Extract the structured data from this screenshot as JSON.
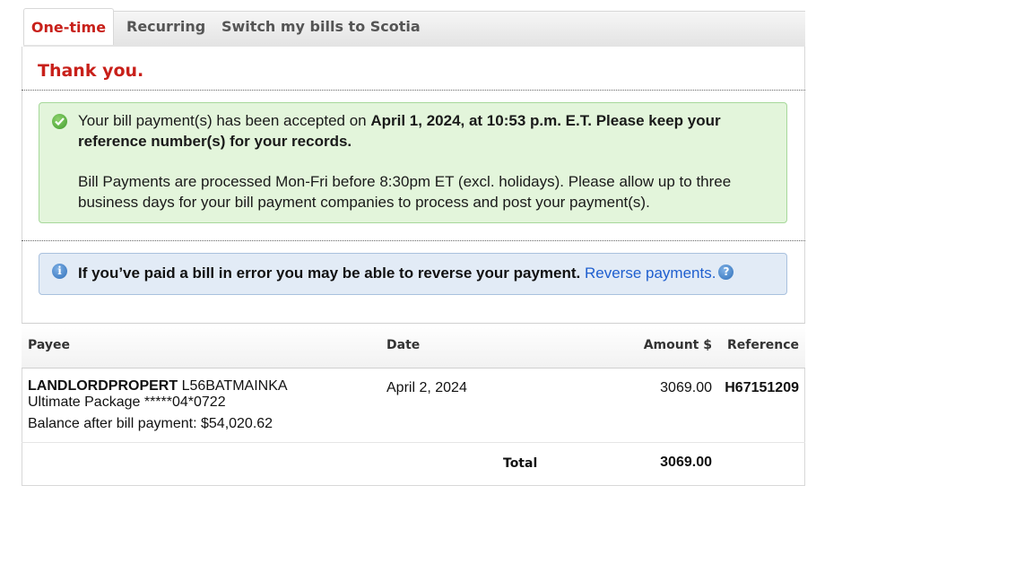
{
  "tabs": [
    {
      "label": "One-time",
      "active": true
    },
    {
      "label": "Recurring",
      "active": false
    },
    {
      "label": "Switch my bills to Scotia",
      "active": false
    }
  ],
  "heading": "Thank you.",
  "success": {
    "text_plain": "Your bill payment(s) has been accepted on ",
    "text_bold": "April 1, 2024, at 10:53 p.m. E.T. Please keep your reference number(s) for your records.",
    "processing_note": "Bill Payments are processed Mon-Fri before 8:30pm ET (excl. holidays). Please allow up to three business days for your bill payment companies to process and post your payment(s).",
    "icon": "check-circle-icon",
    "color": "#e3f5db"
  },
  "info": {
    "text": "If you’ve paid a bill in error you may be able to reverse your payment.",
    "link": "Reverse payments.",
    "icon": "info-icon",
    "help_icon": "question-icon",
    "color": "#e2ebf6"
  },
  "table": {
    "headers": {
      "payee": "Payee",
      "date": "Date",
      "amount": "Amount $",
      "reference": "Reference"
    },
    "rows": [
      {
        "payee_name": "LANDLORDPROPERT",
        "payee_code": "L56BATMAINKA",
        "account": "Ultimate Package *****04*0722",
        "balance": "Balance after bill payment: $54,020.62",
        "date": "April 2, 2024",
        "amount": "3069.00",
        "reference": "H67151209"
      }
    ],
    "total_label": "Total",
    "total_value": "3069.00"
  },
  "colors": {
    "accent": "#c8201a",
    "link": "#1f5fcf"
  }
}
